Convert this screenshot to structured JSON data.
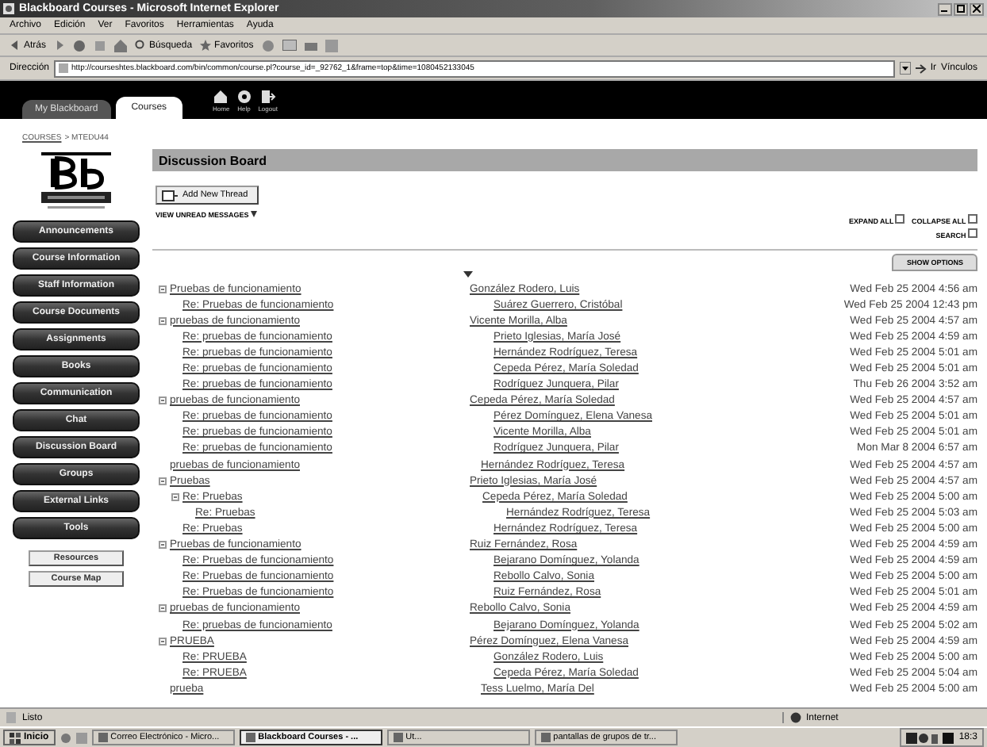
{
  "window": {
    "title": "Blackboard Courses - Microsoft Internet Explorer"
  },
  "menu": [
    "Archivo",
    "Edición",
    "Ver",
    "Favoritos",
    "Herramientas",
    "Ayuda"
  ],
  "toolbar": {
    "back": "Atrás",
    "search": "Búsqueda",
    "favorites": "Favoritos"
  },
  "address": {
    "label": "Dirección",
    "value": "http://courseshtes.blackboard.com/bin/common/course.pl?course_id=_92762_1&frame=top&time=1080452133045",
    "go": "Ir",
    "links": "Vínculos"
  },
  "header": {
    "tabs": [
      {
        "label": "My Blackboard",
        "selected": false
      },
      {
        "label": "Courses",
        "selected": true
      }
    ],
    "icons": [
      {
        "kind": "home",
        "label": "Home"
      },
      {
        "kind": "help",
        "label": "Help"
      },
      {
        "kind": "logout",
        "label": "Logout"
      }
    ]
  },
  "breadcrumb": {
    "link": "COURSES",
    "current": "> MTEDU44"
  },
  "course_menu": [
    "Announcements",
    "Course Information",
    "Staff Information",
    "Course Documents",
    "Assignments",
    "Books",
    "Communication",
    "Chat",
    "Discussion Board",
    "Groups",
    "External Links",
    "Tools"
  ],
  "tool_links": [
    "Resources",
    "Course Map"
  ],
  "board": {
    "title": "Discussion Board",
    "add_button": "Add New Thread",
    "unread": "VIEW UNREAD MESSAGES",
    "expand_all": "EXPAND ALL",
    "collapse_all": "COLLAPSE ALL",
    "search": "SEARCH",
    "options": "SHOW OPTIONS",
    "threads": [
      {
        "subject": "Pruebas de funcionamiento",
        "author": "González Rodero, Luis",
        "date": "Wed Feb 25 2004 4:56 am",
        "children": [
          {
            "subject": "Re: Pruebas de funcionamiento",
            "author": "Suárez Guerrero, Cristóbal",
            "date": "Wed Feb 25 2004 12:43 pm"
          }
        ]
      },
      {
        "subject": "pruebas de funcionamiento",
        "author": "Vicente Morilla, Alba",
        "date": "Wed Feb 25 2004 4:57 am",
        "children": [
          {
            "subject": "Re: pruebas de funcionamiento",
            "author": "Prieto Iglesias, María José",
            "date": "Wed Feb 25 2004 4:59 am"
          },
          {
            "subject": "Re: pruebas de funcionamiento",
            "author": "Hernández Rodríguez, Teresa",
            "date": "Wed Feb 25 2004 5:01 am"
          },
          {
            "subject": "Re: pruebas de funcionamiento",
            "author": "Cepeda Pérez, María Soledad",
            "date": "Wed Feb 25 2004 5:01 am"
          },
          {
            "subject": "Re: pruebas de funcionamiento",
            "author": "Rodríguez Junquera, Pilar",
            "date": "Thu Feb 26 2004 3:52 am"
          }
        ]
      },
      {
        "subject": "pruebas de funcionamiento",
        "author": "Cepeda Pérez, María Soledad",
        "date": "Wed Feb 25 2004 4:57 am",
        "children": [
          {
            "subject": "Re: pruebas de funcionamiento",
            "author": "Pérez Domínguez, Elena Vanesa",
            "date": "Wed Feb 25 2004 5:01 am"
          },
          {
            "subject": "Re: pruebas de funcionamiento",
            "author": "Vicente Morilla, Alba",
            "date": "Wed Feb 25 2004 5:01 am"
          },
          {
            "subject": "Re: pruebas de funcionamiento",
            "author": "Rodríguez Junquera, Pilar",
            "date": "Mon Mar 8 2004 6:57 am"
          }
        ]
      },
      {
        "subject": "pruebas de funcionamiento",
        "author": "Hernández Rodríguez, Teresa",
        "date": "Wed Feb 25 2004 4:57 am"
      },
      {
        "subject": "Pruebas",
        "author": "Prieto Iglesias, María José",
        "date": "Wed Feb 25 2004 4:57 am",
        "children": [
          {
            "subject": "Re: Pruebas",
            "author": "Cepeda Pérez, María Soledad",
            "date": "Wed Feb 25 2004 5:00 am",
            "children": [
              {
                "subject": "Re: Pruebas",
                "author": "Hernández Rodríguez, Teresa",
                "date": "Wed Feb 25 2004 5:03 am"
              }
            ]
          },
          {
            "subject": "Re: Pruebas",
            "author": "Hernández Rodríguez, Teresa",
            "date": "Wed Feb 25 2004 5:00 am"
          }
        ]
      },
      {
        "subject": "Pruebas de funcionamiento",
        "author": "Ruiz Fernández, Rosa",
        "date": "Wed Feb 25 2004 4:59 am",
        "children": [
          {
            "subject": "Re: Pruebas de funcionamiento",
            "author": "Bejarano Domínguez, Yolanda",
            "date": "Wed Feb 25 2004 4:59 am"
          },
          {
            "subject": "Re: Pruebas de funcionamiento",
            "author": "Rebollo Calvo, Sonia",
            "date": "Wed Feb 25 2004 5:00 am"
          },
          {
            "subject": "Re: Pruebas de funcionamiento",
            "author": "Ruiz Fernández, Rosa",
            "date": "Wed Feb 25 2004 5:01 am"
          }
        ]
      },
      {
        "subject": "pruebas de funcionamiento",
        "author": "Rebollo Calvo, Sonia",
        "date": "Wed Feb 25 2004 4:59 am",
        "children": [
          {
            "subject": "Re: pruebas de funcionamiento",
            "author": "Bejarano Domínguez, Yolanda",
            "date": "Wed Feb 25 2004 5:02 am"
          }
        ]
      },
      {
        "subject": "PRUEBA",
        "author": "Pérez Domínguez, Elena Vanesa",
        "date": "Wed Feb 25 2004 4:59 am",
        "children": [
          {
            "subject": "Re: PRUEBA",
            "author": "González Rodero, Luis",
            "date": "Wed Feb 25 2004 5:00 am"
          },
          {
            "subject": "Re: PRUEBA",
            "author": "Cepeda Pérez, María Soledad",
            "date": "Wed Feb 25 2004 5:04 am"
          }
        ]
      },
      {
        "subject": "prueba",
        "author": "Tess Luelmo, María Del",
        "date": "Wed Feb 25 2004 5:00 am"
      }
    ]
  },
  "status_bar": {
    "text": "Listo",
    "zone": "Internet"
  },
  "taskbar": {
    "start": "Inicio",
    "tasks": [
      {
        "label": "Correo Electrónico - Micro...",
        "selected": false
      },
      {
        "label": "Blackboard Courses - ...",
        "selected": true
      },
      {
        "label": "Ut...",
        "selected": false
      },
      {
        "label": "pantallas de grupos de tr...",
        "selected": false
      }
    ],
    "clock": "18:3"
  }
}
